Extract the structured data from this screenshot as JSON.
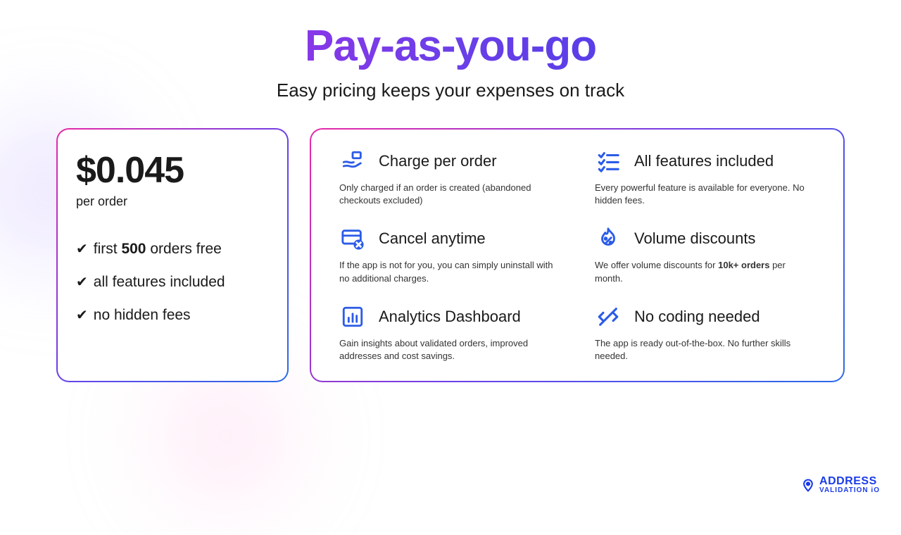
{
  "title": "Pay-as-you-go",
  "subtitle": "Easy pricing keeps your expenses on track",
  "price": {
    "amount": "$0.045",
    "unit": "per order"
  },
  "benefits": [
    {
      "pre": "first ",
      "bold": "500",
      "post": " orders free"
    },
    {
      "text": "all features included"
    },
    {
      "text": "no hidden fees"
    }
  ],
  "features": [
    {
      "icon": "hand-icon",
      "title": "Charge per order",
      "desc": "Only charged if an order is created (abandoned checkouts excluded)"
    },
    {
      "icon": "checklist-icon",
      "title": "All features included",
      "desc": "Every powerful feature is available for everyone. No hidden fees."
    },
    {
      "icon": "cancel-card-icon",
      "title": "Cancel anytime",
      "desc": "If the app is not for you, you can simply uninstall with no additional charges."
    },
    {
      "icon": "flame-percent-icon",
      "title": "Volume discounts",
      "desc_pre": "We offer volume discounts for ",
      "desc_bold": "10k+ orders",
      "desc_post": " per month."
    },
    {
      "icon": "analytics-icon",
      "title": "Analytics Dashboard",
      "desc": "Gain insights about validated orders, improved addresses and cost savings."
    },
    {
      "icon": "no-code-icon",
      "title": "No coding needed",
      "desc": "The app is ready out-of-the-box. No further skills needed."
    }
  ],
  "logo": {
    "line1": "ADDRESS",
    "line2": "VALIDATION iO"
  }
}
